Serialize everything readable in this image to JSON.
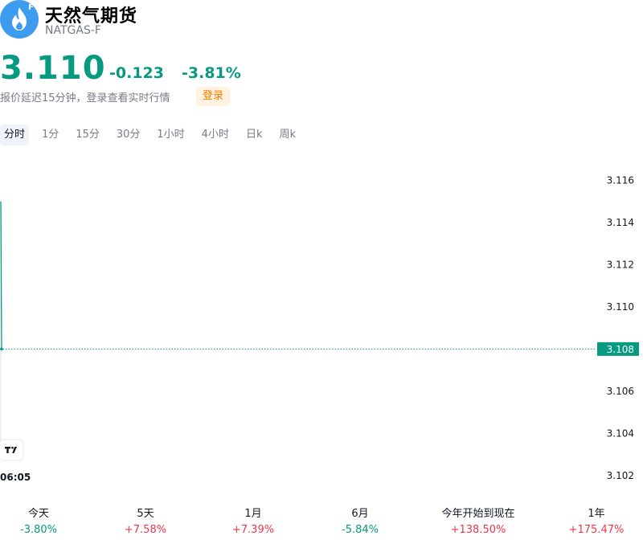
{
  "header": {
    "logo_badge": "F",
    "logo_icon": "flame-icon",
    "title": "天然气期货",
    "ticker": "NATGAS-F"
  },
  "quote": {
    "price": "3.110",
    "change": "-0.123",
    "change_pct": "-3.81%",
    "delay_note": "报价延迟15分钟，登录查看实时行情",
    "login_label": "登录"
  },
  "intervals": [
    "分时",
    "1分",
    "15分",
    "30分",
    "1小时",
    "4小时",
    "日k",
    "周k"
  ],
  "active_interval": 0,
  "chart_data": {
    "type": "line",
    "y_ticks": [
      "3.116",
      "3.114",
      "3.112",
      "3.110",
      "3.108",
      "3.106",
      "3.104",
      "3.102"
    ],
    "ylim": [
      3.1015,
      3.1175
    ],
    "x_tick_labels": [
      "06:05"
    ],
    "series": [
      {
        "values": [
          3.115,
          3.108
        ]
      }
    ],
    "last_price_label": "3.108",
    "colors": {
      "line": "#089981",
      "label_bg": "#089981"
    }
  },
  "periods": [
    {
      "label": "今天",
      "value": "-3.80%",
      "dir": "down"
    },
    {
      "label": "5天",
      "value": "+7.58%",
      "dir": "up"
    },
    {
      "label": "1月",
      "value": "+7.39%",
      "dir": "up"
    },
    {
      "label": "6月",
      "value": "-5.84%",
      "dir": "down"
    },
    {
      "label": "今年开始到现在",
      "value": "+138.50%",
      "dir": "up"
    },
    {
      "label": "1年",
      "value": "+175.47%",
      "dir": "up"
    }
  ],
  "colors": {
    "down": "#089981",
    "up": "#f23645",
    "accent": "#f57c00"
  }
}
